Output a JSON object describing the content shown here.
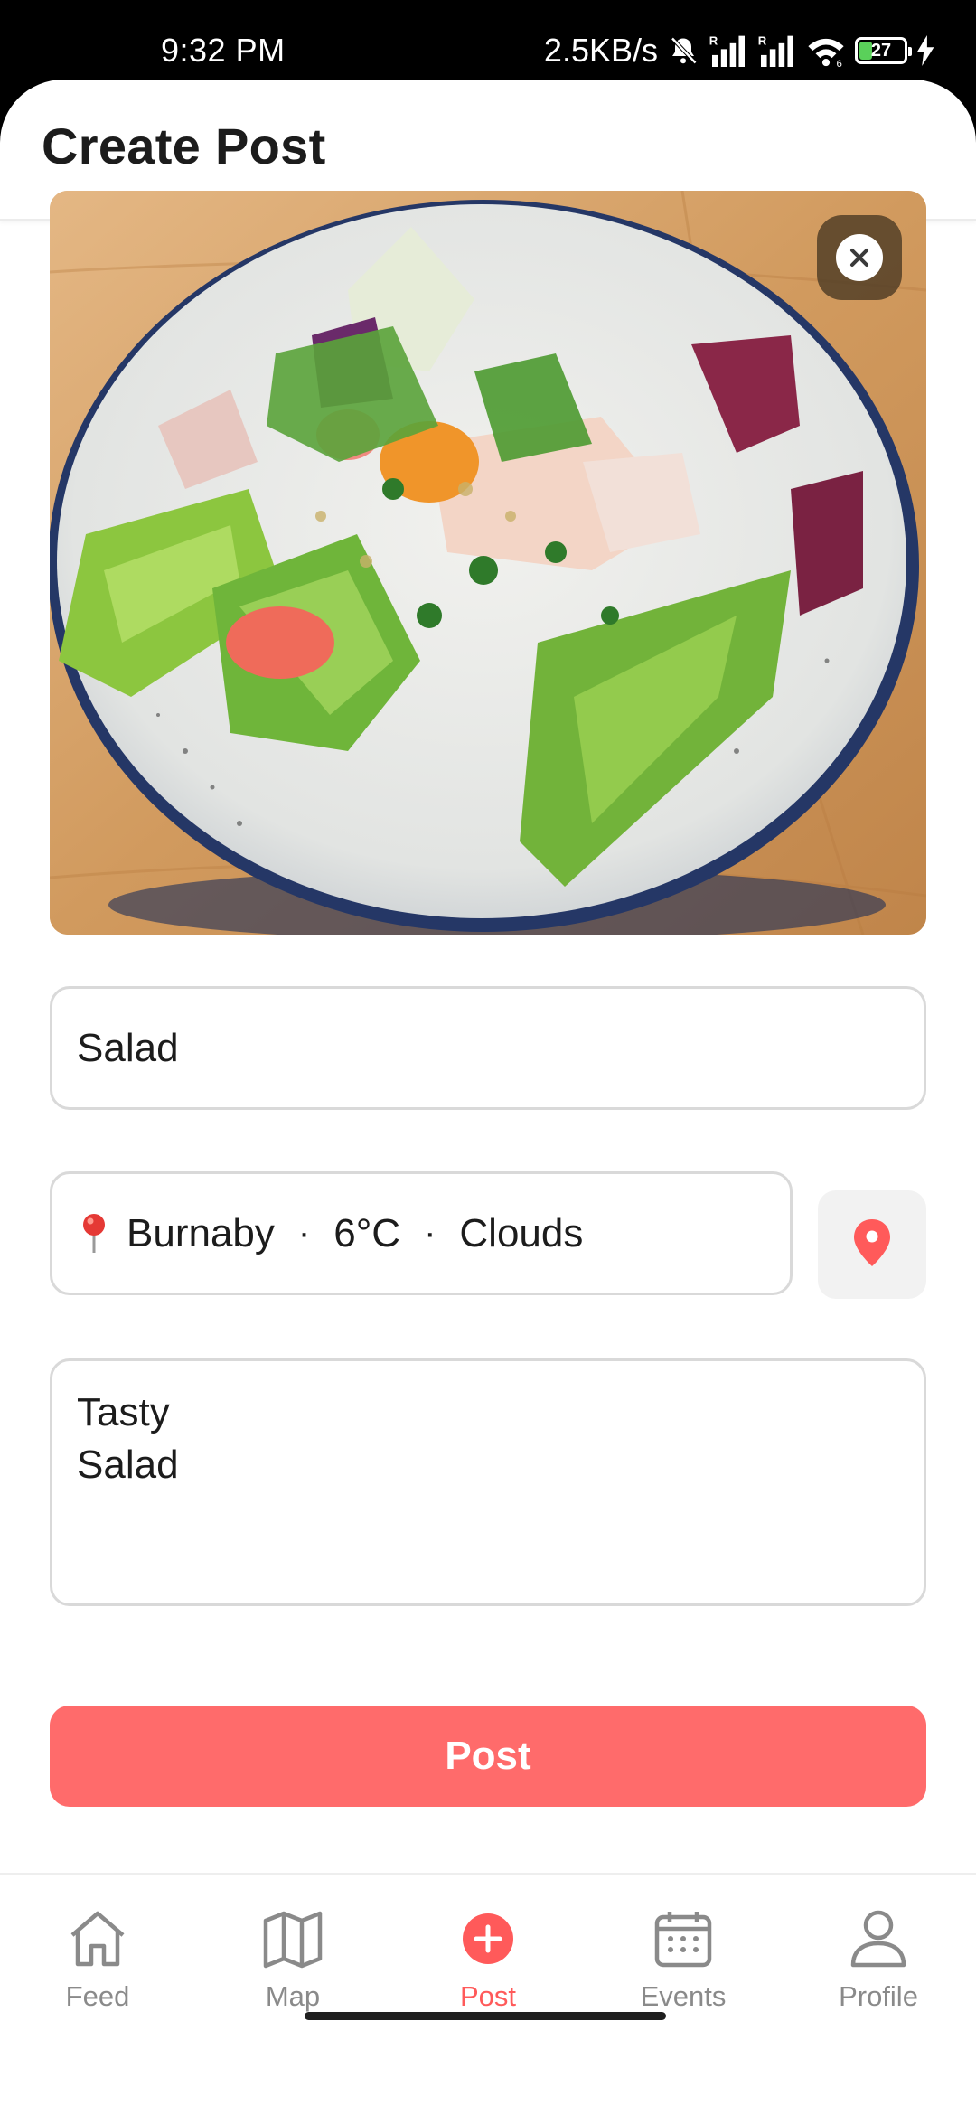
{
  "status_bar": {
    "time": "9:32 PM",
    "network_speed": "2.5KB/s",
    "battery_level": "27",
    "icons": [
      "bell-off-icon",
      "signal-icon",
      "signal-icon",
      "wifi-icon",
      "battery-icon",
      "charging-bolt-icon"
    ]
  },
  "header": {
    "title": "Create Post"
  },
  "photo": {
    "subject": "salad-photo",
    "remove_icon": "close-icon"
  },
  "form": {
    "title_value": "Salad",
    "location": {
      "city": "Burnaby",
      "separator": "·",
      "temperature": "6°C",
      "weather": "Clouds"
    },
    "description_value": "Tasty\nSalad",
    "submit_label": "Post"
  },
  "bottom_nav": {
    "items": [
      {
        "label": "Feed",
        "icon": "home-icon"
      },
      {
        "label": "Map",
        "icon": "map-icon"
      },
      {
        "label": "Post",
        "icon": "plus-circle-icon"
      },
      {
        "label": "Events",
        "icon": "calendar-icon"
      },
      {
        "label": "Profile",
        "icon": "person-icon"
      }
    ],
    "active_index": 2
  },
  "colors": {
    "accent": "#ff6b6b",
    "active_nav": "#ff5a5a",
    "inactive_nav": "#8a8a8a",
    "field_border": "#d9d9d9"
  }
}
